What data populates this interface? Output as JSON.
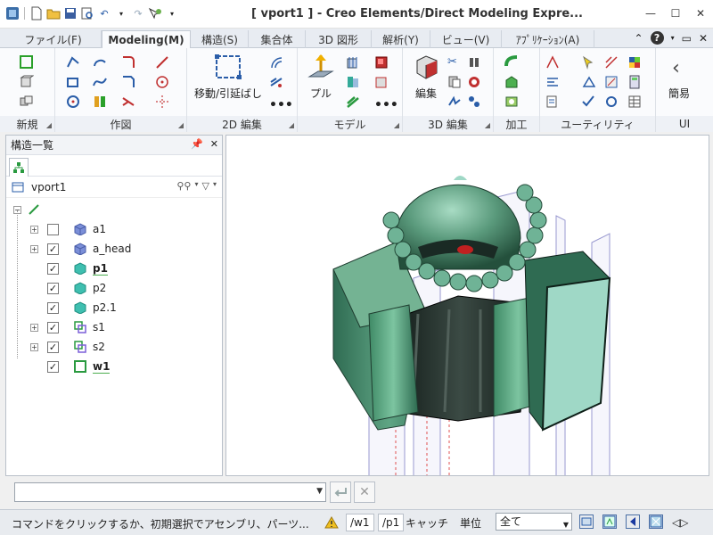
{
  "window": {
    "title": "[ vport1 ] - Creo Elements/Direct Modeling Expre..."
  },
  "tabs": [
    {
      "label": "ファイル(F)"
    },
    {
      "label": "Modeling(M)",
      "active": true
    },
    {
      "label": "構造(S)"
    },
    {
      "label": "集合体"
    },
    {
      "label": "3D 図形"
    },
    {
      "label": "解析(Y)"
    },
    {
      "label": "ビュー(V)"
    },
    {
      "label": "ｱﾌﾟﾘｹｰｼｮﾝ(A)"
    }
  ],
  "ribbon": {
    "groups": [
      {
        "label": "新規"
      },
      {
        "label": "作図"
      },
      {
        "label": "2D 編集"
      },
      {
        "label": "モデル"
      },
      {
        "label": "3D 編集"
      },
      {
        "label": "加工"
      },
      {
        "label": "ユーティリティ"
      },
      {
        "label": "UI"
      }
    ],
    "big_buttons": {
      "move_stretch": "移動/引延ばし",
      "pull": "プル",
      "edit": "編集",
      "simple": "簡易"
    }
  },
  "structure_panel": {
    "title": "構造一覧",
    "root": "vport1",
    "items": [
      {
        "label": "a1",
        "checked": false,
        "expandable": true
      },
      {
        "label": "a_head",
        "checked": true,
        "expandable": true
      },
      {
        "label": "p1",
        "checked": true,
        "expandable": false,
        "bold": true
      },
      {
        "label": "p2",
        "checked": true,
        "expandable": false
      },
      {
        "label": "p2.1",
        "checked": true,
        "expandable": false
      },
      {
        "label": "s1",
        "checked": true,
        "expandable": true
      },
      {
        "label": "s2",
        "checked": true,
        "expandable": true
      },
      {
        "label": "w1",
        "checked": true,
        "expandable": false,
        "bold": true
      }
    ]
  },
  "command_bar": {
    "input_value": ""
  },
  "status_bar": {
    "message": "コマンドをクリックするか、初期選択でアセンブリ、パーツ...",
    "workplane": "/w1",
    "part": "/p1",
    "catch_label": "キャッチ",
    "unit_label": "単位",
    "unit_value": "全て"
  },
  "colors": {
    "model_green": "#4f8f70",
    "model_light": "#9fd8c6",
    "model_dark": "#1d2b26",
    "accent_blue": "#2f6fb5"
  }
}
